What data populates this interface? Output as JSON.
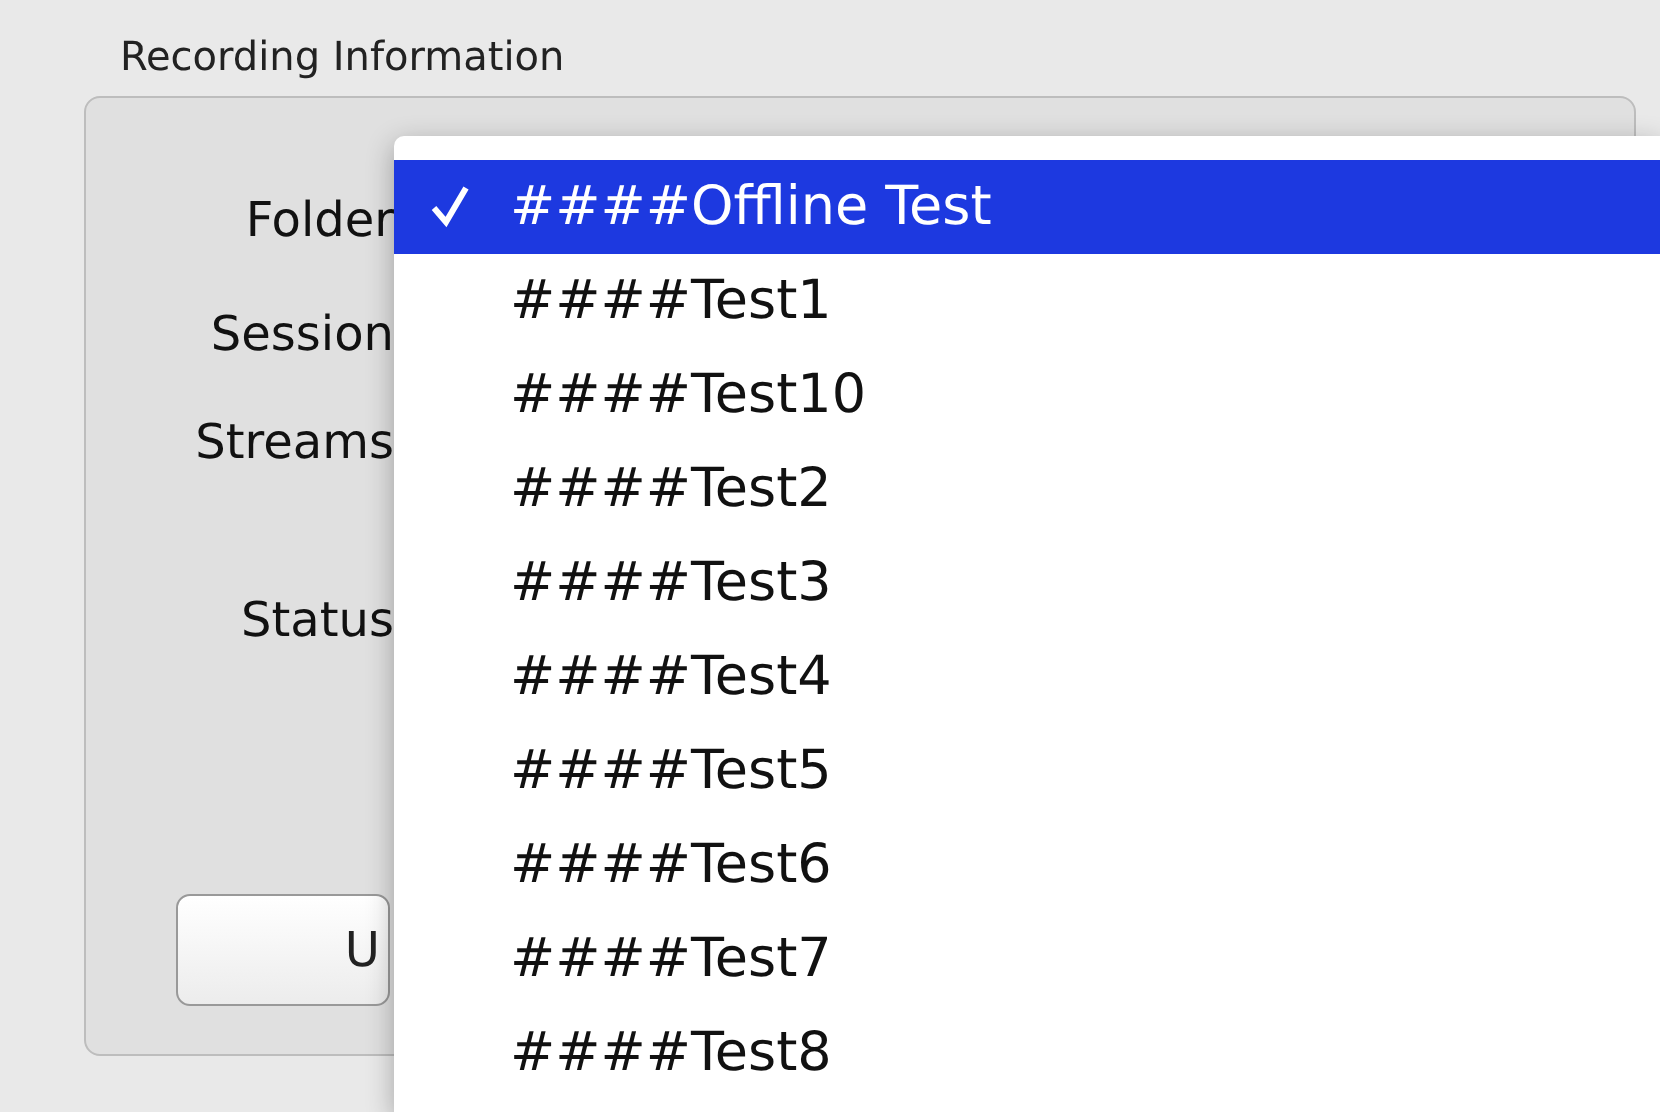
{
  "group": {
    "title": "Recording Information",
    "fields": [
      {
        "label": "Folder"
      },
      {
        "label": "Session"
      },
      {
        "label": "Streams"
      },
      {
        "label": "Status"
      }
    ],
    "button": {
      "label": "U"
    }
  },
  "folder_menu": {
    "items": [
      {
        "label": "####Offline Test",
        "selected": true
      },
      {
        "label": "####Test1",
        "selected": false
      },
      {
        "label": "####Test10",
        "selected": false
      },
      {
        "label": "####Test2",
        "selected": false
      },
      {
        "label": "####Test3",
        "selected": false
      },
      {
        "label": "####Test4",
        "selected": false
      },
      {
        "label": "####Test5",
        "selected": false
      },
      {
        "label": "####Test6",
        "selected": false
      },
      {
        "label": "####Test7",
        "selected": false
      },
      {
        "label": "####Test8",
        "selected": false
      }
    ]
  }
}
